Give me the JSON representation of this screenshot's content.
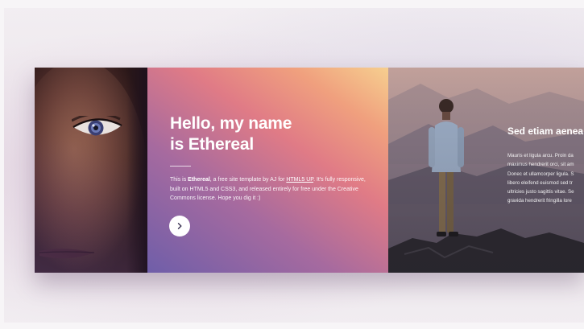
{
  "intro": {
    "title_line1": "Hello, my name",
    "title_line2": "is Ethereal",
    "text_prefix": "This is ",
    "text_strong": "Ethereal",
    "text_mid": ", a free site template by AJ for ",
    "text_link": "HTML5 UP",
    "text_suffix": ". It's fully responsive, built on HTML5 and CSS3, and released entirely for free under the Creative Commons license. Hope you dig it :)",
    "next_button_icon": "chevron-right-icon"
  },
  "second_panel": {
    "title": "Sed etiam aenea",
    "text_lines": [
      "Mauris et ligula arcu. Proin da",
      "maximus hendrerit orci, sit am",
      "Donec et ullamcorper ligula. S",
      "libero eleifend euismod sed tr",
      "ultricies justo sagittis vitae. Se",
      "gravida hendrerit fringilla lore"
    ]
  },
  "colors": {
    "gradient_start": "#6f5ea9",
    "gradient_mid": "#e07b86",
    "gradient_end": "#f6cf8f",
    "button_bg": "#ffffff",
    "text": "#ffffff"
  }
}
